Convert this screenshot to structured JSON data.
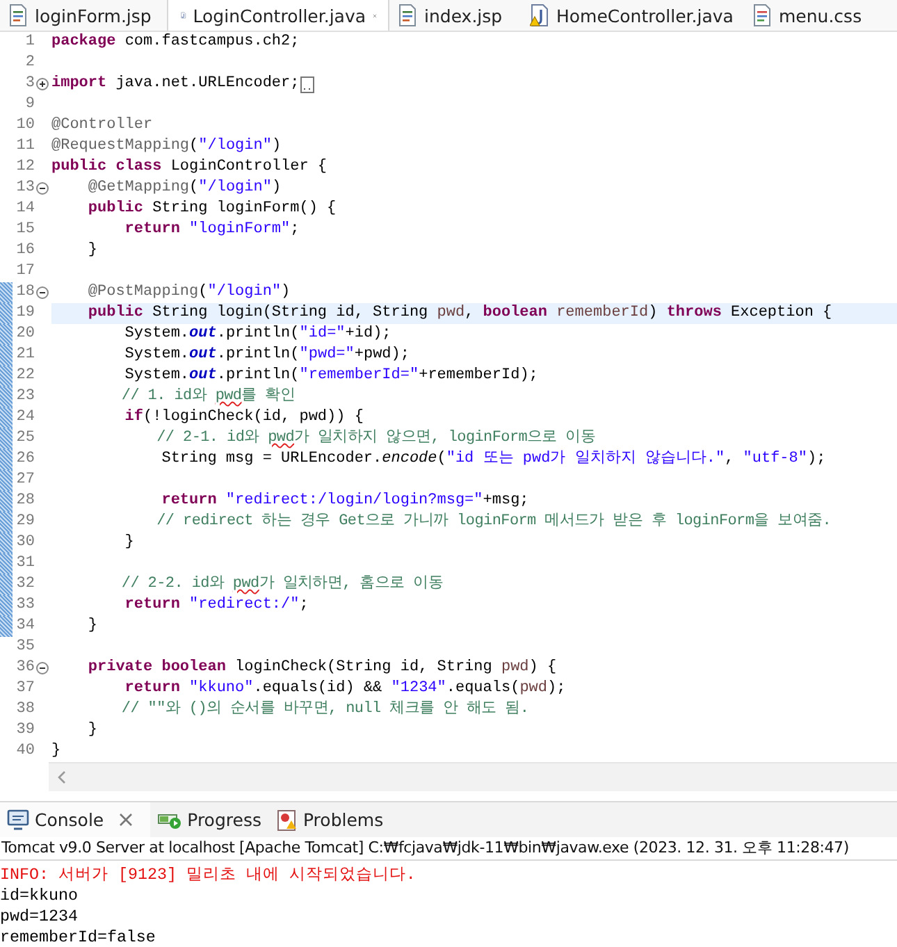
{
  "editor_tabs": [
    {
      "label": "loginForm.jsp",
      "kind": "jsp",
      "warning": false,
      "selected": false
    },
    {
      "label": "LoginController.java",
      "kind": "java",
      "warning": false,
      "selected": true
    },
    {
      "label": "index.jsp",
      "kind": "jsp",
      "warning": false,
      "selected": false
    },
    {
      "label": "HomeController.java",
      "kind": "java",
      "warning": true,
      "selected": false
    },
    {
      "label": "menu.css",
      "kind": "css",
      "warning": false,
      "selected": false
    }
  ],
  "code_lines": [
    {
      "number": "1",
      "kind": "plain",
      "changed": false,
      "current": false,
      "tokens": [
        {
          "kind": "keyword",
          "text": "package"
        },
        {
          "kind": "plain",
          "text": " com.fastcampus.ch2;"
        }
      ]
    },
    {
      "number": "2",
      "kind": "plain",
      "changed": false,
      "current": false
    },
    {
      "number": "3",
      "kind": "folded",
      "changed": false,
      "current": false,
      "tokens": [
        {
          "kind": "keyword",
          "text": "import"
        },
        {
          "kind": "plain",
          "text": " java.net.URLEncoder;"
        }
      ]
    },
    {
      "number": "9",
      "kind": "plain",
      "changed": false,
      "current": false
    },
    {
      "number": "10",
      "kind": "plain",
      "changed": false,
      "current": false,
      "tokens": [
        {
          "kind": "annotation",
          "text": "@Controller"
        }
      ]
    },
    {
      "number": "11",
      "kind": "plain",
      "changed": false,
      "current": false,
      "tokens": [
        {
          "kind": "annotation",
          "text": "@RequestMapping"
        },
        {
          "kind": "plain",
          "text": "("
        },
        {
          "kind": "string",
          "text": "\"/login\""
        },
        {
          "kind": "plain",
          "text": ")"
        }
      ]
    },
    {
      "number": "12",
      "kind": "plain",
      "changed": false,
      "current": false,
      "tokens": [
        {
          "kind": "keyword",
          "text": "public class"
        },
        {
          "kind": "plain",
          "text": " LoginController {"
        }
      ]
    },
    {
      "number": "13",
      "kind": "foldable",
      "changed": false,
      "current": false,
      "tokens": [
        {
          "kind": "annotation",
          "text": "    @GetMapping"
        },
        {
          "kind": "plain",
          "text": "("
        },
        {
          "kind": "string",
          "text": "\"/login\""
        },
        {
          "kind": "plain",
          "text": ")"
        }
      ]
    },
    {
      "number": "14",
      "kind": "plain",
      "changed": false,
      "current": false,
      "tokens": [
        {
          "kind": "keyword",
          "text": "    public"
        },
        {
          "kind": "plain",
          "text": " String loginForm() {"
        }
      ]
    },
    {
      "number": "15",
      "kind": "plain",
      "changed": false,
      "current": false,
      "tokens": [
        {
          "kind": "keyword",
          "text": "        return"
        },
        {
          "kind": "string",
          "text": " \"loginForm\""
        },
        {
          "kind": "plain",
          "text": ";"
        }
      ]
    },
    {
      "number": "16",
      "kind": "plain",
      "changed": false,
      "current": false,
      "tokens": [
        {
          "kind": "plain",
          "text": "    }"
        }
      ]
    },
    {
      "number": "17",
      "kind": "plain",
      "changed": false,
      "current": false
    },
    {
      "number": "18",
      "kind": "foldable",
      "changed": true,
      "current": false,
      "tokens": [
        {
          "kind": "annotation",
          "text": "    @PostMapping"
        },
        {
          "kind": "plain",
          "text": "("
        },
        {
          "kind": "string",
          "text": "\"/login\""
        },
        {
          "kind": "plain",
          "text": ")"
        }
      ]
    },
    {
      "number": "19",
      "kind": "plain",
      "changed": true,
      "current": true,
      "tokens": [
        {
          "kind": "keyword",
          "text": "    public"
        },
        {
          "kind": "plain",
          "text": " String login(String id, String "
        },
        {
          "kind": "parameter",
          "text": "pwd"
        },
        {
          "kind": "plain",
          "text": ", "
        },
        {
          "kind": "keyword",
          "text": "boolean"
        },
        {
          "kind": "parameter",
          "text": " rememberId"
        },
        {
          "kind": "plain",
          "text": ") "
        },
        {
          "kind": "keyword",
          "text": "throws"
        },
        {
          "kind": "plain",
          "text": " Exception {"
        }
      ]
    },
    {
      "number": "20",
      "kind": "plain",
      "changed": true,
      "current": false,
      "tokens": [
        {
          "kind": "plain",
          "text": "        System."
        },
        {
          "kind": "field",
          "text": "out"
        },
        {
          "kind": "plain",
          "text": ".println("
        },
        {
          "kind": "string",
          "text": "\"id=\""
        },
        {
          "kind": "plain",
          "text": "+id);"
        }
      ]
    },
    {
      "number": "21",
      "kind": "plain",
      "changed": true,
      "current": false,
      "tokens": [
        {
          "kind": "plain",
          "text": "        System."
        },
        {
          "kind": "field",
          "text": "out"
        },
        {
          "kind": "plain",
          "text": ".println("
        },
        {
          "kind": "string",
          "text": "\"pwd=\""
        },
        {
          "kind": "plain",
          "text": "+pwd);"
        }
      ]
    },
    {
      "number": "22",
      "kind": "plain",
      "changed": true,
      "current": false,
      "tokens": [
        {
          "kind": "plain",
          "text": "        System."
        },
        {
          "kind": "field",
          "text": "out"
        },
        {
          "kind": "plain",
          "text": ".println("
        },
        {
          "kind": "string",
          "text": "\"rememberId=\""
        },
        {
          "kind": "plain",
          "text": "+rememberId);"
        }
      ]
    },
    {
      "number": "23",
      "kind": "plain",
      "changed": true,
      "current": false,
      "tokens": [
        {
          "kind": "comment",
          "text": "        // 1. id와 "
        },
        {
          "kind": "misspelled",
          "text": "pwd"
        },
        {
          "kind": "comment",
          "text": "를 확인"
        }
      ]
    },
    {
      "number": "24",
      "kind": "plain",
      "changed": true,
      "current": false,
      "tokens": [
        {
          "kind": "keyword",
          "text": "        if"
        },
        {
          "kind": "plain",
          "text": "(!loginCheck(id, pwd)) {"
        }
      ]
    },
    {
      "number": "25",
      "kind": "plain",
      "changed": true,
      "current": false,
      "tokens": [
        {
          "kind": "comment",
          "text": "            // 2-1. id와 "
        },
        {
          "kind": "misspelled",
          "text": "pwd"
        },
        {
          "kind": "comment",
          "text": "가 일치하지 않으면, loginForm으로 이동"
        }
      ]
    },
    {
      "number": "26",
      "kind": "plain",
      "changed": true,
      "current": false,
      "tokens": [
        {
          "kind": "plain",
          "text": "            String msg = URLEncoder."
        },
        {
          "kind": "static",
          "text": "encode"
        },
        {
          "kind": "plain",
          "text": "("
        },
        {
          "kind": "string",
          "text": "\"id 또는 pwd가 일치하지 않습니다.\""
        },
        {
          "kind": "plain",
          "text": ", "
        },
        {
          "kind": "string",
          "text": "\"utf-8\""
        },
        {
          "kind": "plain",
          "text": ");"
        }
      ]
    },
    {
      "number": "27",
      "kind": "plain",
      "changed": true,
      "current": false
    },
    {
      "number": "28",
      "kind": "plain",
      "changed": true,
      "current": false,
      "tokens": [
        {
          "kind": "keyword",
          "text": "            return"
        },
        {
          "kind": "string",
          "text": " \"redirect:/login/login?msg=\""
        },
        {
          "kind": "plain",
          "text": "+msg;"
        }
      ]
    },
    {
      "number": "29",
      "kind": "plain",
      "changed": true,
      "current": false,
      "tokens": [
        {
          "kind": "comment",
          "text": "            // redirect 하는 경우 Get으로 가니까 loginForm 메서드가 받은 후 loginForm을 보여줌."
        }
      ]
    },
    {
      "number": "30",
      "kind": "plain",
      "changed": true,
      "current": false,
      "tokens": [
        {
          "kind": "plain",
          "text": "        }"
        }
      ]
    },
    {
      "number": "31",
      "kind": "plain",
      "changed": true,
      "current": false
    },
    {
      "number": "32",
      "kind": "plain",
      "changed": true,
      "current": false,
      "tokens": [
        {
          "kind": "comment",
          "text": "        // 2-2. id와 "
        },
        {
          "kind": "misspelled",
          "text": "pwd"
        },
        {
          "kind": "comment",
          "text": "가 일치하면, 홈으로 이동"
        }
      ]
    },
    {
      "number": "33",
      "kind": "plain",
      "changed": true,
      "current": false,
      "tokens": [
        {
          "kind": "keyword",
          "text": "        return"
        },
        {
          "kind": "string",
          "text": " \"redirect:/\""
        },
        {
          "kind": "plain",
          "text": ";"
        }
      ]
    },
    {
      "number": "34",
      "kind": "plain",
      "changed": true,
      "current": false,
      "tokens": [
        {
          "kind": "plain",
          "text": "    }"
        }
      ]
    },
    {
      "number": "35",
      "kind": "plain",
      "changed": false,
      "current": false
    },
    {
      "number": "36",
      "kind": "foldable",
      "changed": false,
      "current": false,
      "tokens": [
        {
          "kind": "keyword",
          "text": "    private boolean"
        },
        {
          "kind": "plain",
          "text": " loginCheck(String id, String "
        },
        {
          "kind": "parameter",
          "text": "pwd"
        },
        {
          "kind": "plain",
          "text": ") {"
        }
      ]
    },
    {
      "number": "37",
      "kind": "plain",
      "changed": false,
      "current": false,
      "tokens": [
        {
          "kind": "keyword",
          "text": "        return"
        },
        {
          "kind": "string",
          "text": " \"kkuno\""
        },
        {
          "kind": "plain",
          "text": ".equals(id) && "
        },
        {
          "kind": "string",
          "text": "\"1234\""
        },
        {
          "kind": "plain",
          "text": ".equals("
        },
        {
          "kind": "parameter",
          "text": "pwd"
        },
        {
          "kind": "plain",
          "text": ");"
        }
      ]
    },
    {
      "number": "38",
      "kind": "plain",
      "changed": false,
      "current": false,
      "tokens": [
        {
          "kind": "comment",
          "text": "        // \"\"와 ()의 순서를 바꾸면, null 체크를 안 해도 됨."
        }
      ]
    },
    {
      "number": "39",
      "kind": "plain",
      "changed": false,
      "current": false,
      "tokens": [
        {
          "kind": "plain",
          "text": "    }"
        }
      ]
    },
    {
      "number": "40",
      "kind": "plain",
      "changed": false,
      "current": false,
      "tokens": [
        {
          "kind": "plain",
          "text": "}"
        }
      ]
    }
  ],
  "console_tabs": [
    {
      "label": "Console",
      "kind": "console",
      "selected": true
    },
    {
      "label": "Progress",
      "kind": "progress",
      "selected": false
    },
    {
      "label": "Problems",
      "kind": "problems",
      "selected": false
    }
  ],
  "console": {
    "header": "Tomcat v9.0 Server at localhost [Apache Tomcat] C:₩fcjava₩jdk-11₩bin₩javaw.exe  (2023. 12. 31. 오후 11:28:47)",
    "lines": [
      {
        "kind": "error",
        "text": "INFO: 서버가 [9123] 밀리초 내에 시작되었습니다."
      },
      {
        "kind": "output",
        "text": "id=kkuno"
      },
      {
        "kind": "output",
        "text": "pwd=1234"
      },
      {
        "kind": "output",
        "text": "rememberId=false"
      }
    ]
  }
}
